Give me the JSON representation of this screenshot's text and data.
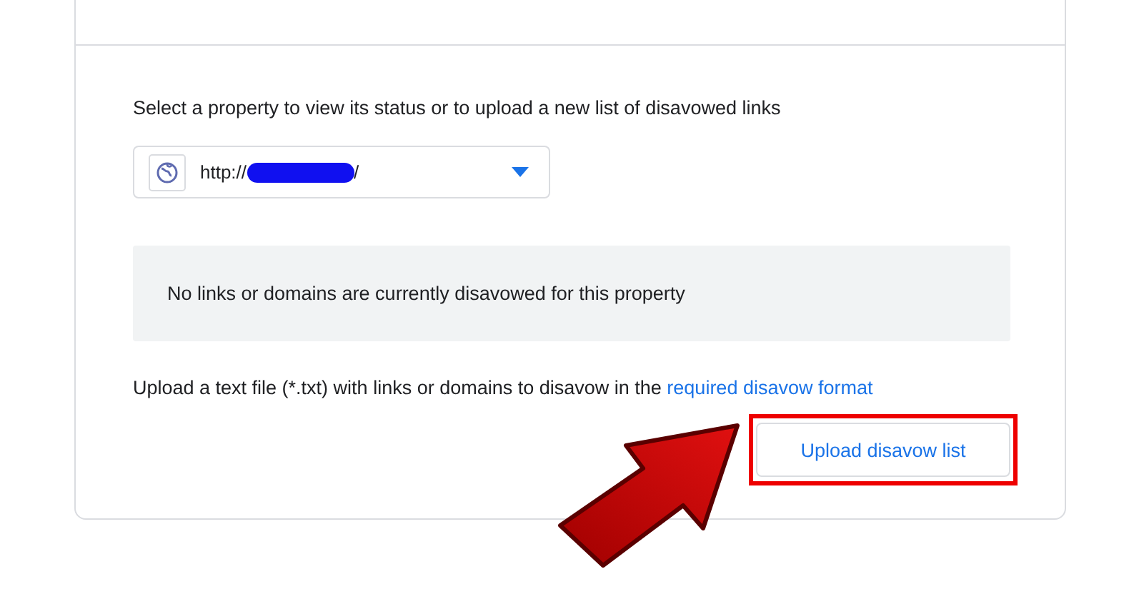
{
  "intro": "Select a property to view its status or to upload a new list of disavowed links",
  "property_select": {
    "value_prefix": "http://",
    "value_suffix": "/"
  },
  "status_message": "No links or domains are currently disavowed for this property",
  "upload_hint": {
    "text": "Upload a text file (*.txt) with links or domains to disavow in the ",
    "link": "required disavow format"
  },
  "upload_button": {
    "label": "Upload disavow list",
    "highlighted": true
  }
}
